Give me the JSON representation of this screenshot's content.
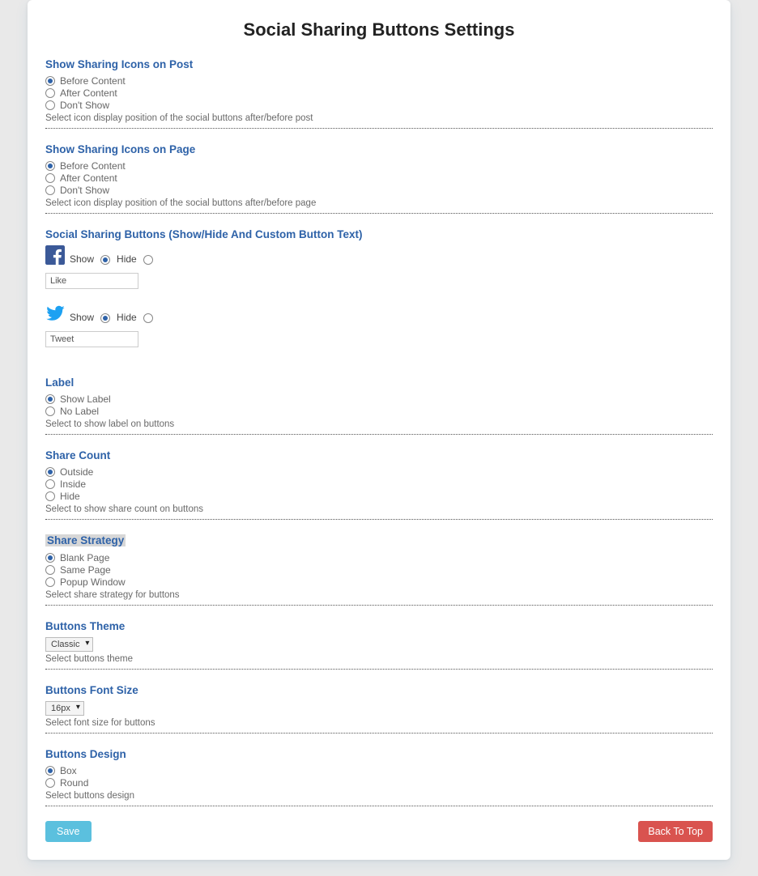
{
  "page_title": "Social Sharing Buttons Settings",
  "sections": {
    "icons_post": {
      "title": "Show Sharing Icons on Post",
      "options": [
        "Before Content",
        "After Content",
        "Don't Show"
      ],
      "help": "Select icon display position of the social buttons after/before post"
    },
    "icons_page": {
      "title": "Show Sharing Icons on Page",
      "options": [
        "Before Content",
        "After Content",
        "Don't Show"
      ],
      "help": "Select icon display position of the social buttons after/before page"
    },
    "social_buttons": {
      "title": "Social Sharing Buttons (Show/Hide And Custom Button Text)",
      "show_label": "Show",
      "hide_label": "Hide",
      "facebook_value": "Like",
      "twitter_value": "Tweet"
    },
    "label": {
      "title": "Label",
      "options": [
        "Show Label",
        "No Label"
      ],
      "help": "Select to show label on buttons"
    },
    "share_count": {
      "title": "Share Count",
      "options": [
        "Outside",
        "Inside",
        "Hide"
      ],
      "help": "Select to show share count on buttons"
    },
    "share_strategy": {
      "title": "Share Strategy",
      "options": [
        "Blank Page",
        "Same Page",
        "Popup Window"
      ],
      "help": "Select share strategy for buttons"
    },
    "buttons_theme": {
      "title": "Buttons Theme",
      "value": "Classic",
      "help": "Select buttons theme"
    },
    "buttons_font_size": {
      "title": "Buttons Font Size",
      "value": "16px",
      "help": "Select font size for buttons"
    },
    "buttons_design": {
      "title": "Buttons Design",
      "options": [
        "Box",
        "Round"
      ],
      "help": "Select buttons design"
    }
  },
  "footer": {
    "save": "Save",
    "back_to_top": "Back To Top"
  }
}
